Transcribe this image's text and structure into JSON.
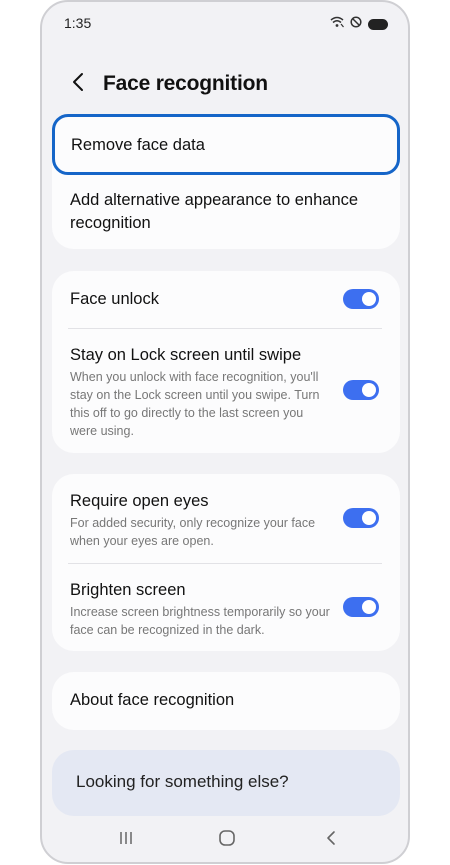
{
  "status_bar": {
    "time": "1:35"
  },
  "header": {
    "title": "Face recognition"
  },
  "face_data": {
    "remove_label": "Remove face data",
    "add_alt_label": "Add alternative appearance to enhance recognition"
  },
  "unlock": {
    "face_unlock": {
      "label": "Face unlock",
      "enabled": true
    },
    "stay_on_lock": {
      "label": "Stay on Lock screen until swipe",
      "desc": "When you unlock with face recognition, you'll stay on the Lock screen until you swipe. Turn this off to go directly to the last screen you were using.",
      "enabled": true
    }
  },
  "security": {
    "open_eyes": {
      "label": "Require open eyes",
      "desc": "For added security, only recognize your face when your eyes are open.",
      "enabled": true
    },
    "brighten": {
      "label": "Brighten screen",
      "desc": "Increase screen brightness temporarily so your face can be recognized in the dark.",
      "enabled": true
    }
  },
  "about": {
    "label": "About face recognition"
  },
  "suggestions": {
    "label": "Looking for something else?"
  },
  "colors": {
    "accent": "#3d6ff0",
    "focus": "#1565c8",
    "background": "#f2f2f5"
  }
}
